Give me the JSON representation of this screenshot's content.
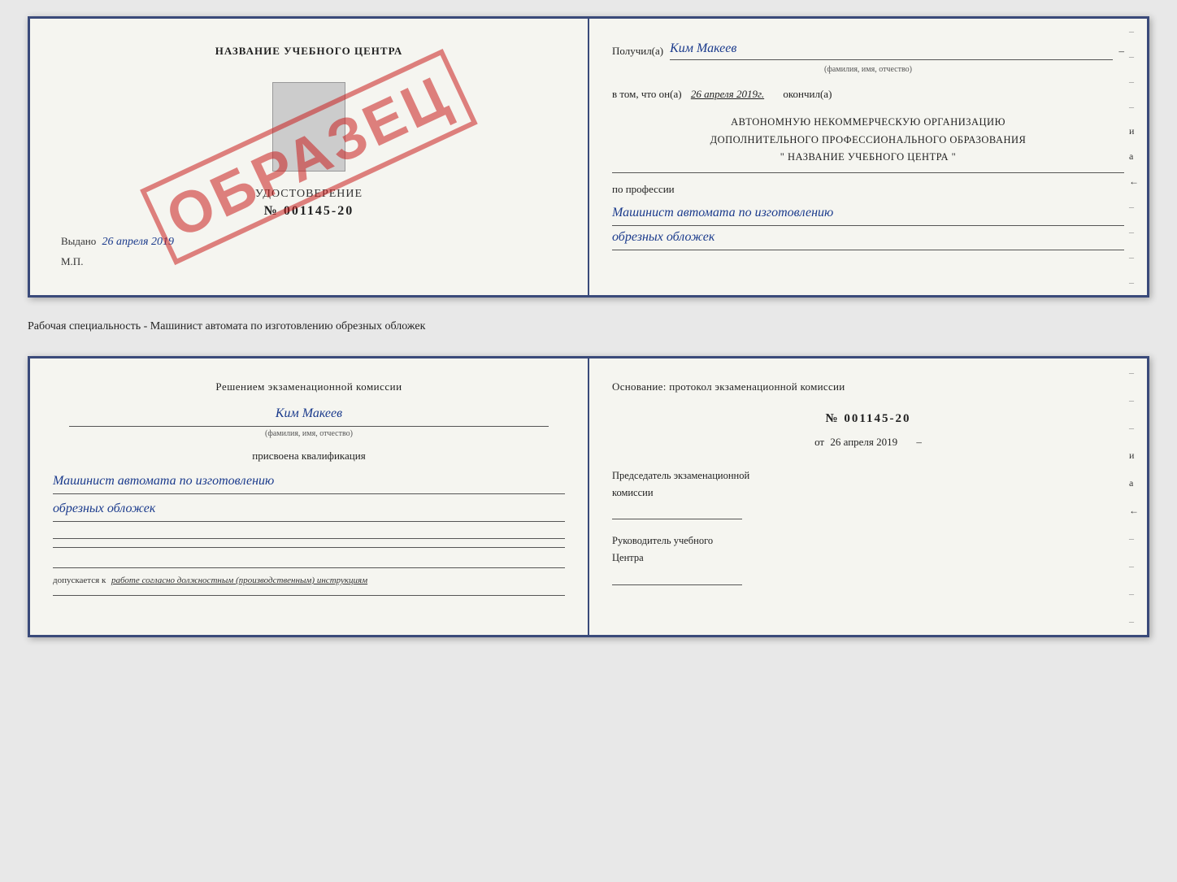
{
  "top_document": {
    "left": {
      "center_title": "НАЗВАНИЕ УЧЕБНОГО ЦЕНТРА",
      "watermark": "ОБРАЗЕЦ",
      "udostoverenie_label": "УДОСТОВЕРЕНИЕ",
      "udostoverenie_number": "№ 001145-20",
      "vydano_label": "Выдано",
      "vydano_date": "26 апреля 2019",
      "mp_label": "М.П."
    },
    "right": {
      "poluchil_label": "Получил(а)",
      "recipient_name": "Ким Макеев",
      "fio_sub": "(фамилия, имя, отчество)",
      "vtom_label": "в том, что он(а)",
      "vtom_date": "26 апреля 2019г.",
      "okonchil_label": "окончил(а)",
      "org_line1": "АВТОНОМНУЮ НЕКОММЕРЧЕСКУЮ ОРГАНИЗАЦИЮ",
      "org_line2": "ДОПОЛНИТЕЛЬНОГО ПРОФЕССИОНАЛЬНОГО ОБРАЗОВАНИЯ",
      "org_line3": "\"  НАЗВАНИЕ УЧЕБНОГО ЦЕНТРА  \"",
      "profession_label": "по профессии",
      "profession_value": "Машинист автомата по изготовлению",
      "profession_value2": "обрезных обложек"
    }
  },
  "specialty_line": "Рабочая специальность - Машинист автомата по изготовлению обрезных обложек",
  "bottom_document": {
    "left": {
      "komissia_title": "Решением экзаменационной комиссии",
      "komissia_name": "Ким Макеев",
      "fio_sub": "(фамилия, имя, отчество)",
      "prisvoyena": "присвоена квалификация",
      "qualification_value": "Машинист автомата по изготовлению",
      "qualification_value2": "обрезных обложек",
      "dopuskaetsya_label": "допускается к",
      "dopusk_text": "работе согласно должностным (производственным) инструкциям"
    },
    "right": {
      "osnovaniye": "Основание: протокол экзаменационной комиссии",
      "protocol_number": "№ 001145-20",
      "protocol_date_label": "от",
      "protocol_date": "26 апреля 2019",
      "predsedatel_label": "Председатель экзаменационной",
      "komissiyi_label": "комиссии",
      "rukovoditel_label": "Руководитель учебного",
      "tsentra_label": "Центра"
    }
  },
  "side_marks": {
    "right_top": [
      "–",
      "–",
      "и",
      "а",
      "←",
      "–",
      "–",
      "–",
      "–"
    ],
    "right_bottom": [
      "–",
      "–",
      "–",
      "и",
      "а",
      "←",
      "–",
      "–",
      "–",
      "–"
    ]
  }
}
